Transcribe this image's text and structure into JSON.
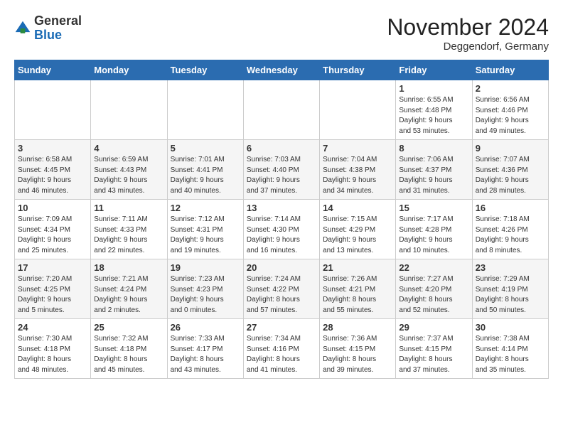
{
  "header": {
    "logo_general": "General",
    "logo_blue": "Blue",
    "month_title": "November 2024",
    "location": "Deggendorf, Germany"
  },
  "days_of_week": [
    "Sunday",
    "Monday",
    "Tuesday",
    "Wednesday",
    "Thursday",
    "Friday",
    "Saturday"
  ],
  "weeks": [
    [
      {
        "day": "",
        "info": ""
      },
      {
        "day": "",
        "info": ""
      },
      {
        "day": "",
        "info": ""
      },
      {
        "day": "",
        "info": ""
      },
      {
        "day": "",
        "info": ""
      },
      {
        "day": "1",
        "info": "Sunrise: 6:55 AM\nSunset: 4:48 PM\nDaylight: 9 hours\nand 53 minutes."
      },
      {
        "day": "2",
        "info": "Sunrise: 6:56 AM\nSunset: 4:46 PM\nDaylight: 9 hours\nand 49 minutes."
      }
    ],
    [
      {
        "day": "3",
        "info": "Sunrise: 6:58 AM\nSunset: 4:45 PM\nDaylight: 9 hours\nand 46 minutes."
      },
      {
        "day": "4",
        "info": "Sunrise: 6:59 AM\nSunset: 4:43 PM\nDaylight: 9 hours\nand 43 minutes."
      },
      {
        "day": "5",
        "info": "Sunrise: 7:01 AM\nSunset: 4:41 PM\nDaylight: 9 hours\nand 40 minutes."
      },
      {
        "day": "6",
        "info": "Sunrise: 7:03 AM\nSunset: 4:40 PM\nDaylight: 9 hours\nand 37 minutes."
      },
      {
        "day": "7",
        "info": "Sunrise: 7:04 AM\nSunset: 4:38 PM\nDaylight: 9 hours\nand 34 minutes."
      },
      {
        "day": "8",
        "info": "Sunrise: 7:06 AM\nSunset: 4:37 PM\nDaylight: 9 hours\nand 31 minutes."
      },
      {
        "day": "9",
        "info": "Sunrise: 7:07 AM\nSunset: 4:36 PM\nDaylight: 9 hours\nand 28 minutes."
      }
    ],
    [
      {
        "day": "10",
        "info": "Sunrise: 7:09 AM\nSunset: 4:34 PM\nDaylight: 9 hours\nand 25 minutes."
      },
      {
        "day": "11",
        "info": "Sunrise: 7:11 AM\nSunset: 4:33 PM\nDaylight: 9 hours\nand 22 minutes."
      },
      {
        "day": "12",
        "info": "Sunrise: 7:12 AM\nSunset: 4:31 PM\nDaylight: 9 hours\nand 19 minutes."
      },
      {
        "day": "13",
        "info": "Sunrise: 7:14 AM\nSunset: 4:30 PM\nDaylight: 9 hours\nand 16 minutes."
      },
      {
        "day": "14",
        "info": "Sunrise: 7:15 AM\nSunset: 4:29 PM\nDaylight: 9 hours\nand 13 minutes."
      },
      {
        "day": "15",
        "info": "Sunrise: 7:17 AM\nSunset: 4:28 PM\nDaylight: 9 hours\nand 10 minutes."
      },
      {
        "day": "16",
        "info": "Sunrise: 7:18 AM\nSunset: 4:26 PM\nDaylight: 9 hours\nand 8 minutes."
      }
    ],
    [
      {
        "day": "17",
        "info": "Sunrise: 7:20 AM\nSunset: 4:25 PM\nDaylight: 9 hours\nand 5 minutes."
      },
      {
        "day": "18",
        "info": "Sunrise: 7:21 AM\nSunset: 4:24 PM\nDaylight: 9 hours\nand 2 minutes."
      },
      {
        "day": "19",
        "info": "Sunrise: 7:23 AM\nSunset: 4:23 PM\nDaylight: 9 hours\nand 0 minutes."
      },
      {
        "day": "20",
        "info": "Sunrise: 7:24 AM\nSunset: 4:22 PM\nDaylight: 8 hours\nand 57 minutes."
      },
      {
        "day": "21",
        "info": "Sunrise: 7:26 AM\nSunset: 4:21 PM\nDaylight: 8 hours\nand 55 minutes."
      },
      {
        "day": "22",
        "info": "Sunrise: 7:27 AM\nSunset: 4:20 PM\nDaylight: 8 hours\nand 52 minutes."
      },
      {
        "day": "23",
        "info": "Sunrise: 7:29 AM\nSunset: 4:19 PM\nDaylight: 8 hours\nand 50 minutes."
      }
    ],
    [
      {
        "day": "24",
        "info": "Sunrise: 7:30 AM\nSunset: 4:18 PM\nDaylight: 8 hours\nand 48 minutes."
      },
      {
        "day": "25",
        "info": "Sunrise: 7:32 AM\nSunset: 4:18 PM\nDaylight: 8 hours\nand 45 minutes."
      },
      {
        "day": "26",
        "info": "Sunrise: 7:33 AM\nSunset: 4:17 PM\nDaylight: 8 hours\nand 43 minutes."
      },
      {
        "day": "27",
        "info": "Sunrise: 7:34 AM\nSunset: 4:16 PM\nDaylight: 8 hours\nand 41 minutes."
      },
      {
        "day": "28",
        "info": "Sunrise: 7:36 AM\nSunset: 4:15 PM\nDaylight: 8 hours\nand 39 minutes."
      },
      {
        "day": "29",
        "info": "Sunrise: 7:37 AM\nSunset: 4:15 PM\nDaylight: 8 hours\nand 37 minutes."
      },
      {
        "day": "30",
        "info": "Sunrise: 7:38 AM\nSunset: 4:14 PM\nDaylight: 8 hours\nand 35 minutes."
      }
    ]
  ]
}
